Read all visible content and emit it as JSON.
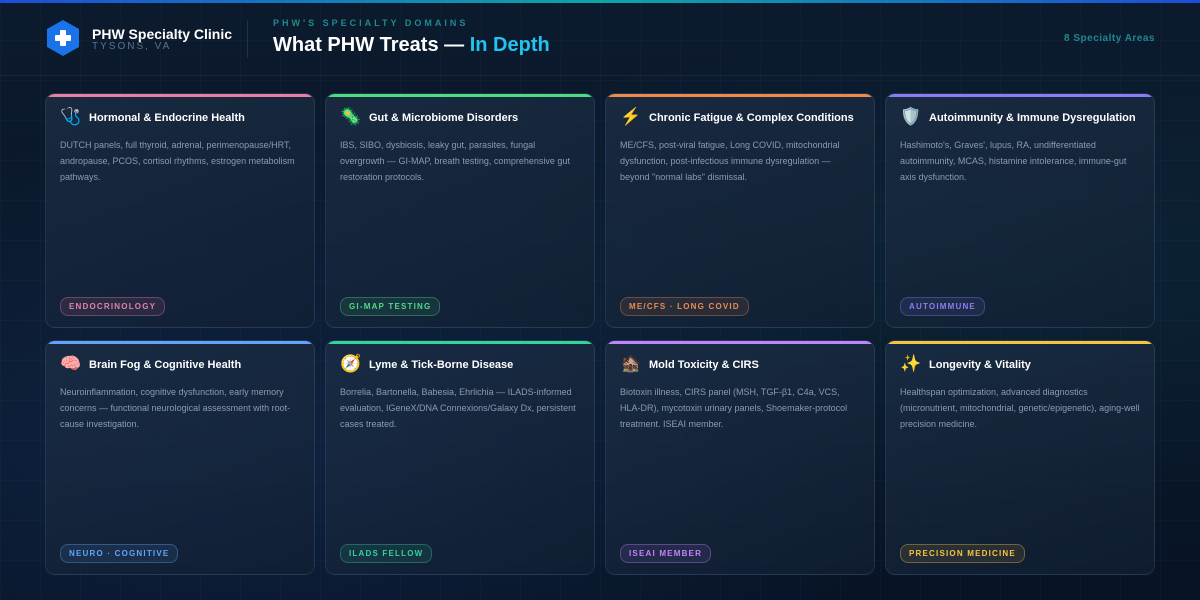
{
  "header": {
    "clinic_name": "PHW Specialty Clinic",
    "clinic_location": "TYSONS, VA",
    "eyebrow": "PHW'S SPECIALTY DOMAINS",
    "title_main": "What PHW Treats — ",
    "title_accent": "In Depth",
    "count": "8 Specialty Areas",
    "logo_icon": "medical-cross-hexagon-icon"
  },
  "colors": {
    "accent": "#22c3ee",
    "teal": "#1e8a8f",
    "background": "#0a1628"
  },
  "cards": [
    {
      "icon": "🩺",
      "icon_name": "stethoscope-icon",
      "title": "Hormonal & Endocrine Health",
      "description": "DUTCH panels, full thyroid, adrenal, perimenopause/HRT, andropause, PCOS, cortisol rhythms, estrogen metabolism pathways.",
      "tag": "ENDOCRINOLOGY",
      "color": "#e87fa6"
    },
    {
      "icon": "🦠",
      "icon_name": "microbe-icon",
      "title": "Gut & Microbiome Disorders",
      "description": "IBS, SIBO, dysbiosis, leaky gut, parasites, fungal overgrowth — GI-MAP, breath testing, comprehensive gut restoration protocols.",
      "tag": "GI-MAP TESTING",
      "color": "#4ade80"
    },
    {
      "icon": "⚡",
      "icon_name": "lightning-icon",
      "title": "Chronic Fatigue & Complex Conditions",
      "description": "ME/CFS, post-viral fatigue, Long COVID, mitochondrial dysfunction, post-infectious immune dysregulation — beyond \"normal labs\" dismissal.",
      "tag": "ME/CFS · LONG COVID",
      "color": "#f08a4b"
    },
    {
      "icon": "🛡️",
      "icon_name": "shield-icon",
      "title": "Autoimmunity & Immune Dysregulation",
      "description": "Hashimoto's, Graves', lupus, RA, undifferentiated autoimmunity, MCAS, histamine intolerance, immune-gut axis dysfunction.",
      "tag": "AUTOIMMUNE",
      "color": "#8b7cf6"
    },
    {
      "icon": "🧠",
      "icon_name": "brain-icon",
      "title": "Brain Fog & Cognitive Health",
      "description": "Neuroinflammation, cognitive dysfunction, early memory concerns — functional neurological assessment with root-cause investigation.",
      "tag": "NEURO · COGNITIVE",
      "color": "#60a5fa"
    },
    {
      "icon": "🧭",
      "icon_name": "compass-icon",
      "title": "Lyme & Tick-Borne Disease",
      "description": "Borrelia, Bartonella, Babesia, Ehrlichia — ILADS-informed evaluation, IGeneX/DNA Connexions/Galaxy Dx, persistent cases treated.",
      "tag": "ILADS FELLOW",
      "color": "#34d399"
    },
    {
      "icon": "🏚️",
      "icon_name": "house-icon",
      "title": "Mold Toxicity & CIRS",
      "description": "Biotoxin illness, CIRS panel (MSH, TGF-β1, C4a, VCS, HLA-DR), mycotoxin urinary panels, Shoemaker-protocol treatment. ISEAI member.",
      "tag": "ISEAI MEMBER",
      "color": "#c084fc"
    },
    {
      "icon": "✨",
      "icon_name": "sparkles-icon",
      "title": "Longevity & Vitality",
      "description": "Healthspan optimization, advanced diagnostics (micronutrient, mitochondrial, genetic/epigenetic), aging-well precision medicine.",
      "tag": "PRECISION MEDICINE",
      "color": "#f5c542"
    }
  ]
}
